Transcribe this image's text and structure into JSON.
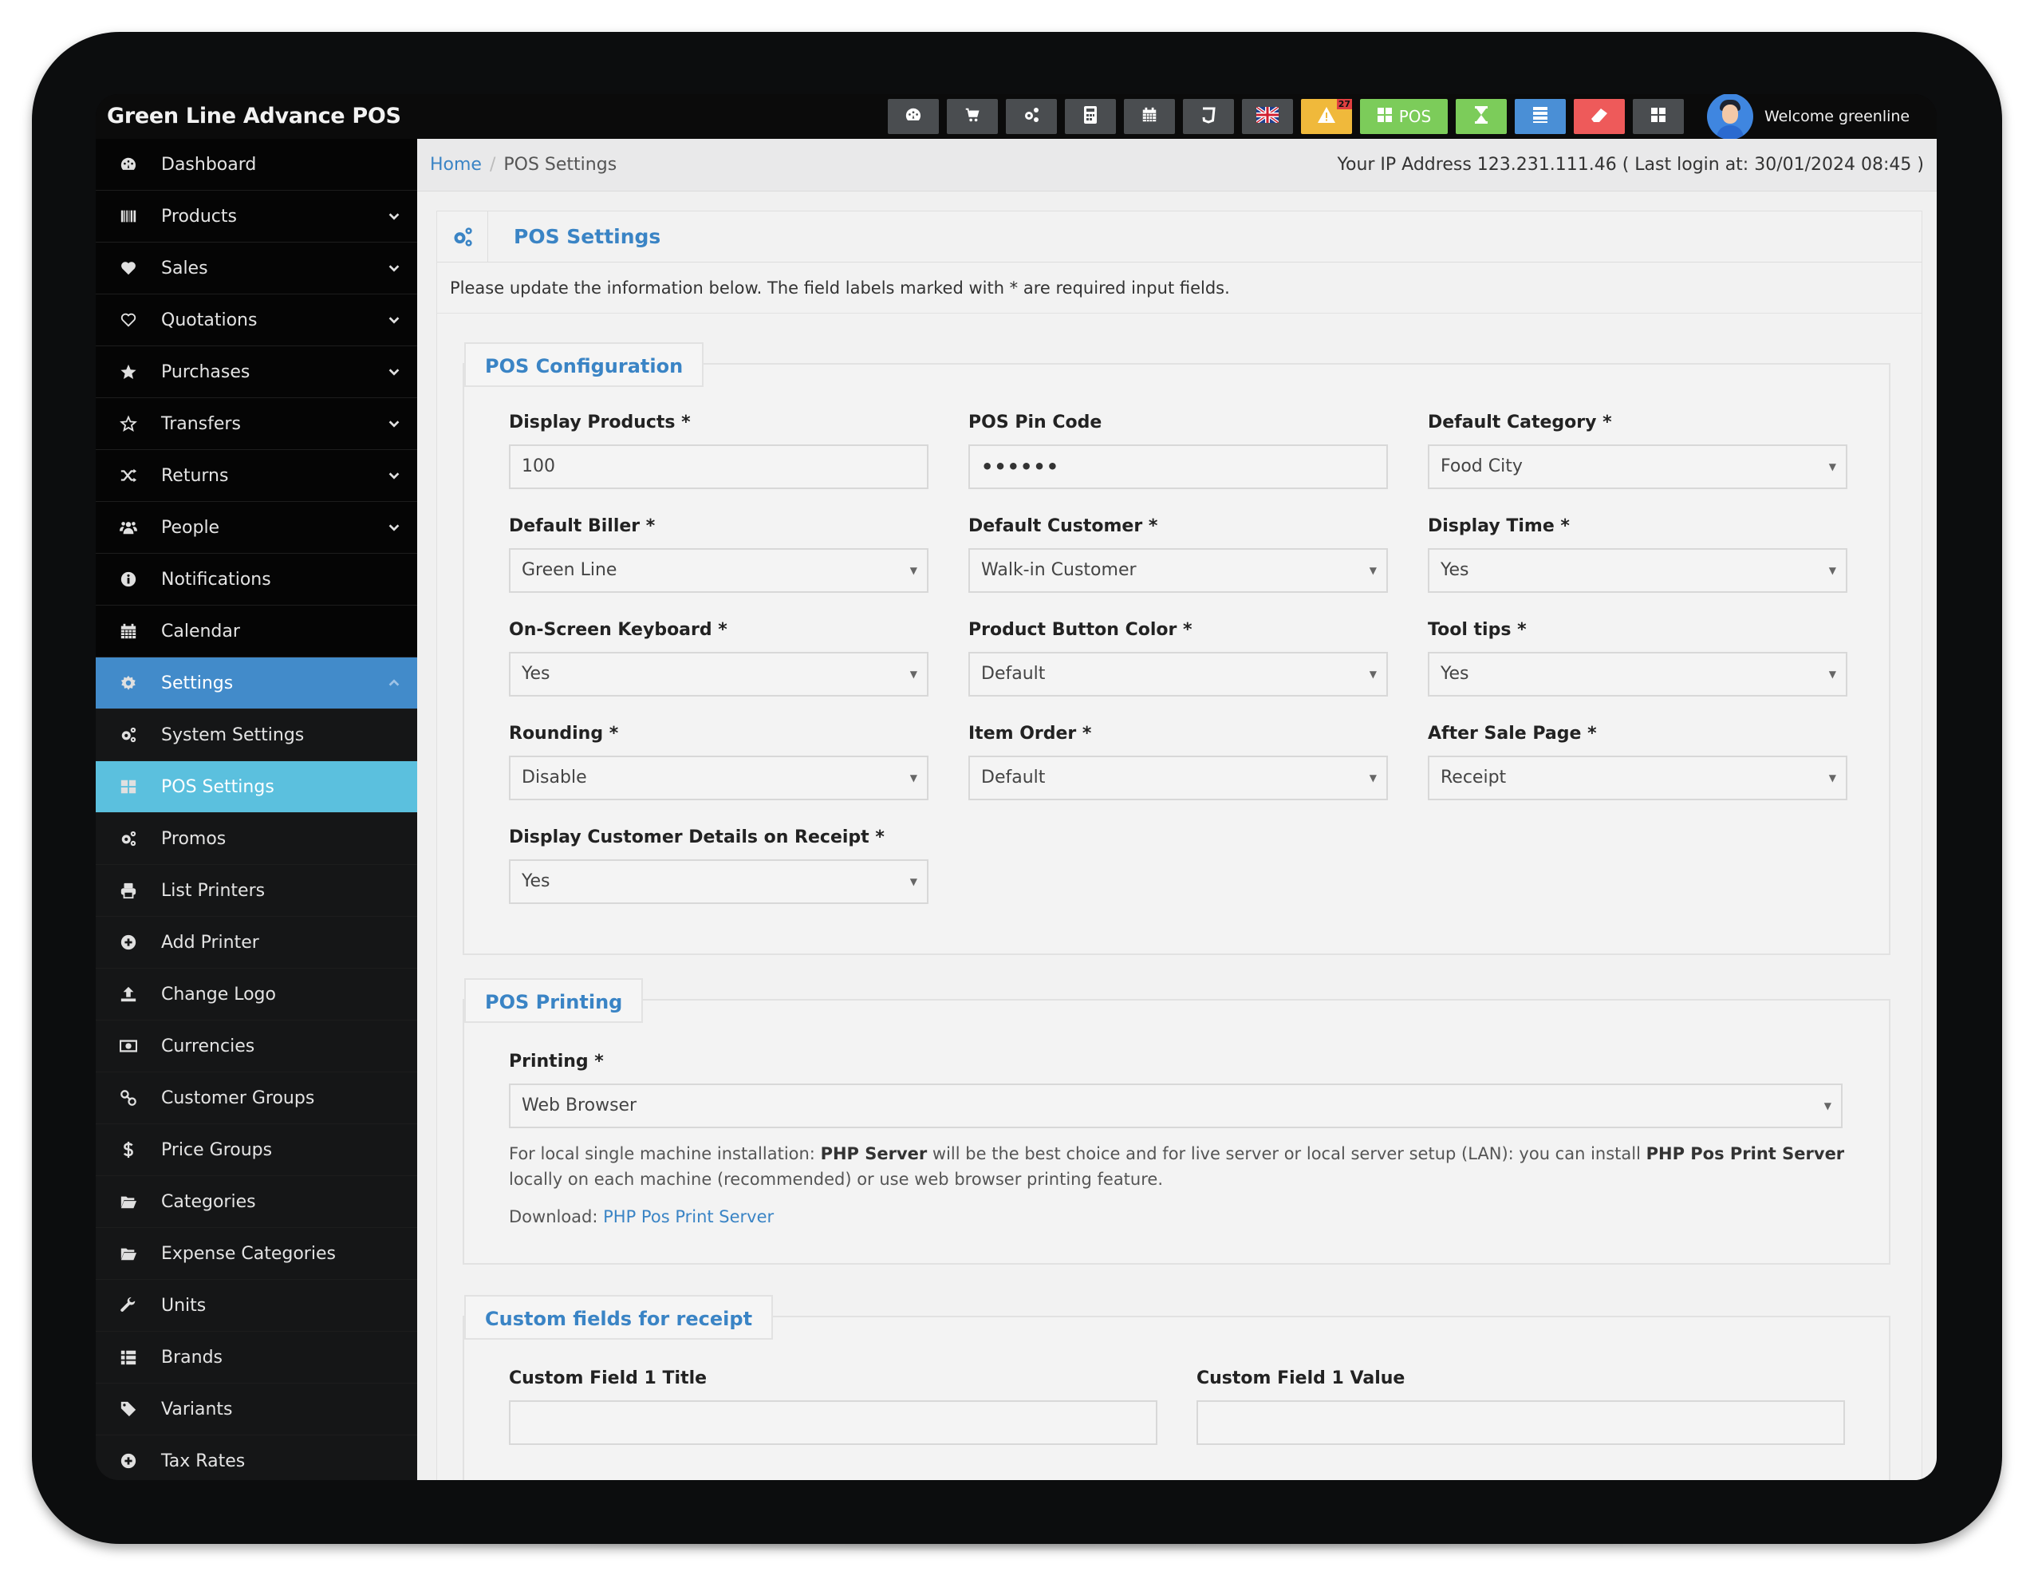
{
  "app": {
    "title": "Green Line Advance POS"
  },
  "toolbar": {
    "buttons": [
      {
        "name": "dashboard",
        "icon": "dashboard-icon",
        "color": "#4a4d50"
      },
      {
        "name": "cart",
        "icon": "cart-icon",
        "color": "#4a4d50"
      },
      {
        "name": "settings",
        "icon": "gears-icon",
        "color": "#4a4d50"
      },
      {
        "name": "calculator",
        "icon": "calculator-icon",
        "color": "#4a4d50"
      },
      {
        "name": "calendar",
        "icon": "calendar-icon",
        "color": "#4a4d50"
      },
      {
        "name": "css",
        "icon": "css3-icon",
        "color": "#4a4d50"
      },
      {
        "name": "language",
        "icon": "uk-flag-icon",
        "color": "#4a4d50"
      },
      {
        "name": "alerts",
        "icon": "warning-icon",
        "color": "#f0b93b",
        "badge": "27"
      },
      {
        "name": "pos",
        "icon": "grid-icon",
        "color": "#7ccc5a",
        "label": "POS"
      },
      {
        "name": "register",
        "icon": "hourglass-icon",
        "color": "#7ccc5a"
      },
      {
        "name": "list",
        "icon": "list-icon",
        "color": "#4a8fd6"
      },
      {
        "name": "clear",
        "icon": "eraser-icon",
        "color": "#ee5a5a"
      },
      {
        "name": "apps",
        "icon": "grid-icon",
        "color": "#4a4d50"
      }
    ],
    "welcome": "Welcome greenline"
  },
  "sidebar": {
    "items": [
      {
        "label": "Dashboard",
        "icon": "dashboard-icon",
        "chevron": false,
        "state": ""
      },
      {
        "label": "Products",
        "icon": "barcode-icon",
        "chevron": true,
        "state": ""
      },
      {
        "label": "Sales",
        "icon": "heart-icon",
        "chevron": true,
        "state": ""
      },
      {
        "label": "Quotations",
        "icon": "heart-outline-icon",
        "chevron": true,
        "state": ""
      },
      {
        "label": "Purchases",
        "icon": "star-icon",
        "chevron": true,
        "state": ""
      },
      {
        "label": "Transfers",
        "icon": "star-outline-icon",
        "chevron": true,
        "state": ""
      },
      {
        "label": "Returns",
        "icon": "shuffle-icon",
        "chevron": true,
        "state": ""
      },
      {
        "label": "People",
        "icon": "users-icon",
        "chevron": true,
        "state": ""
      },
      {
        "label": "Notifications",
        "icon": "info-icon",
        "chevron": false,
        "state": ""
      },
      {
        "label": "Calendar",
        "icon": "calendar-icon",
        "chevron": false,
        "state": ""
      },
      {
        "label": "Settings",
        "icon": "cog-icon",
        "chevron": true,
        "state": "active"
      },
      {
        "label": "System Settings",
        "icon": "gears-icon",
        "chevron": false,
        "state": "sub"
      },
      {
        "label": "POS Settings",
        "icon": "grid-icon",
        "chevron": false,
        "state": "active-sub"
      },
      {
        "label": "Promos",
        "icon": "gears-icon",
        "chevron": false,
        "state": "sub"
      },
      {
        "label": "List Printers",
        "icon": "printer-icon",
        "chevron": false,
        "state": "sub"
      },
      {
        "label": "Add Printer",
        "icon": "plus-circle-icon",
        "chevron": false,
        "state": "sub"
      },
      {
        "label": "Change Logo",
        "icon": "upload-icon",
        "chevron": false,
        "state": "sub"
      },
      {
        "label": "Currencies",
        "icon": "money-icon",
        "chevron": false,
        "state": "sub"
      },
      {
        "label": "Customer Groups",
        "icon": "link-icon",
        "chevron": false,
        "state": "sub"
      },
      {
        "label": "Price Groups",
        "icon": "dollar-icon",
        "chevron": false,
        "state": "sub"
      },
      {
        "label": "Categories",
        "icon": "folder-open-icon",
        "chevron": false,
        "state": "sub"
      },
      {
        "label": "Expense Categories",
        "icon": "folder-open-icon",
        "chevron": false,
        "state": "sub"
      },
      {
        "label": "Units",
        "icon": "wrench-icon",
        "chevron": false,
        "state": "sub"
      },
      {
        "label": "Brands",
        "icon": "list-icon",
        "chevron": false,
        "state": "sub"
      },
      {
        "label": "Variants",
        "icon": "tags-icon",
        "chevron": false,
        "state": "sub"
      },
      {
        "label": "Tax Rates",
        "icon": "plus-circle-icon",
        "chevron": false,
        "state": "sub"
      }
    ]
  },
  "breadcrumb": {
    "home": "Home",
    "current": "POS Settings"
  },
  "ip_info": "Your IP Address 123.231.111.46 ( Last login at: 30/01/2024 08:45 )",
  "page": {
    "title": "POS Settings",
    "intro": "Please update the information below. The field labels marked with * are required input fields."
  },
  "pos_configuration": {
    "legend": "POS Configuration",
    "fields": [
      {
        "label": "Display Products *",
        "value": "100",
        "type": "text"
      },
      {
        "label": "POS Pin Code",
        "value": "••••••",
        "type": "password"
      },
      {
        "label": "Default Category *",
        "value": "Food City",
        "type": "select"
      },
      {
        "label": "Default Biller *",
        "value": "Green Line",
        "type": "select"
      },
      {
        "label": "Default Customer *",
        "value": "Walk-in Customer",
        "type": "select"
      },
      {
        "label": "Display Time *",
        "value": "Yes",
        "type": "select"
      },
      {
        "label": "On-Screen Keyboard *",
        "value": "Yes",
        "type": "select"
      },
      {
        "label": "Product Button Color *",
        "value": "Default",
        "type": "select"
      },
      {
        "label": "Tool tips *",
        "value": "Yes",
        "type": "select"
      },
      {
        "label": "Rounding *",
        "value": "Disable",
        "type": "select"
      },
      {
        "label": "Item Order *",
        "value": "Default",
        "type": "select"
      },
      {
        "label": "After Sale Page *",
        "value": "Receipt",
        "type": "select"
      },
      {
        "label": "Display Customer Details on Receipt *",
        "value": "Yes",
        "type": "select"
      }
    ]
  },
  "pos_printing": {
    "legend": "POS Printing",
    "printing_label": "Printing *",
    "printing_value": "Web Browser",
    "help_part1": "For local single machine installation: ",
    "help_bold1": "PHP Server",
    "help_part2": " will be the best choice and for live server or local server setup (LAN): you can install ",
    "help_bold2": "PHP Pos Print Server",
    "help_part3": " locally on each machine (recommended) or use web browser printing feature.",
    "download_label": "Download: ",
    "download_link": "PHP Pos Print Server"
  },
  "custom_fields": {
    "legend": "Custom fields for receipt",
    "field1_title_label": "Custom Field 1 Title",
    "field1_title_value": "",
    "field1_value_label": "Custom Field 1 Value",
    "field1_value_value": ""
  },
  "colors": {
    "primary": "#3a84c5",
    "active_nav": "#428bca",
    "active_sub_nav": "#5bc0de"
  }
}
